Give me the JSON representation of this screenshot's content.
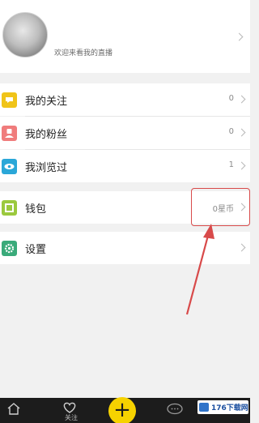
{
  "profile": {
    "welcome_text": "欢迎来看我的直播"
  },
  "menu": {
    "following": {
      "label": "我的关注",
      "value": "0",
      "icon": "heart-badge-icon",
      "color": "#f0c419"
    },
    "fans": {
      "label": "我的粉丝",
      "value": "0",
      "icon": "person-icon",
      "color": "#f07c7c"
    },
    "viewed": {
      "label": "我浏览过",
      "value": "1",
      "icon": "eye-icon",
      "color": "#2aa7d8"
    },
    "wallet": {
      "label": "钱包",
      "value": "0星币",
      "icon": "wallet-icon",
      "color": "#9bc93e"
    },
    "settings": {
      "label": "设置",
      "icon": "gear-icon",
      "color": "#3aaa7a"
    }
  },
  "tabbar": {
    "home_icon": "home-icon",
    "follow_icon": "heart-icon",
    "follow_label": "关注",
    "create_label": "+",
    "chat_icon": "chat-icon",
    "background": "#1c1c1c",
    "accent": "#f6d200"
  },
  "watermark": {
    "text": "176下载网"
  },
  "annotation": {
    "color": "#d84a4a"
  }
}
